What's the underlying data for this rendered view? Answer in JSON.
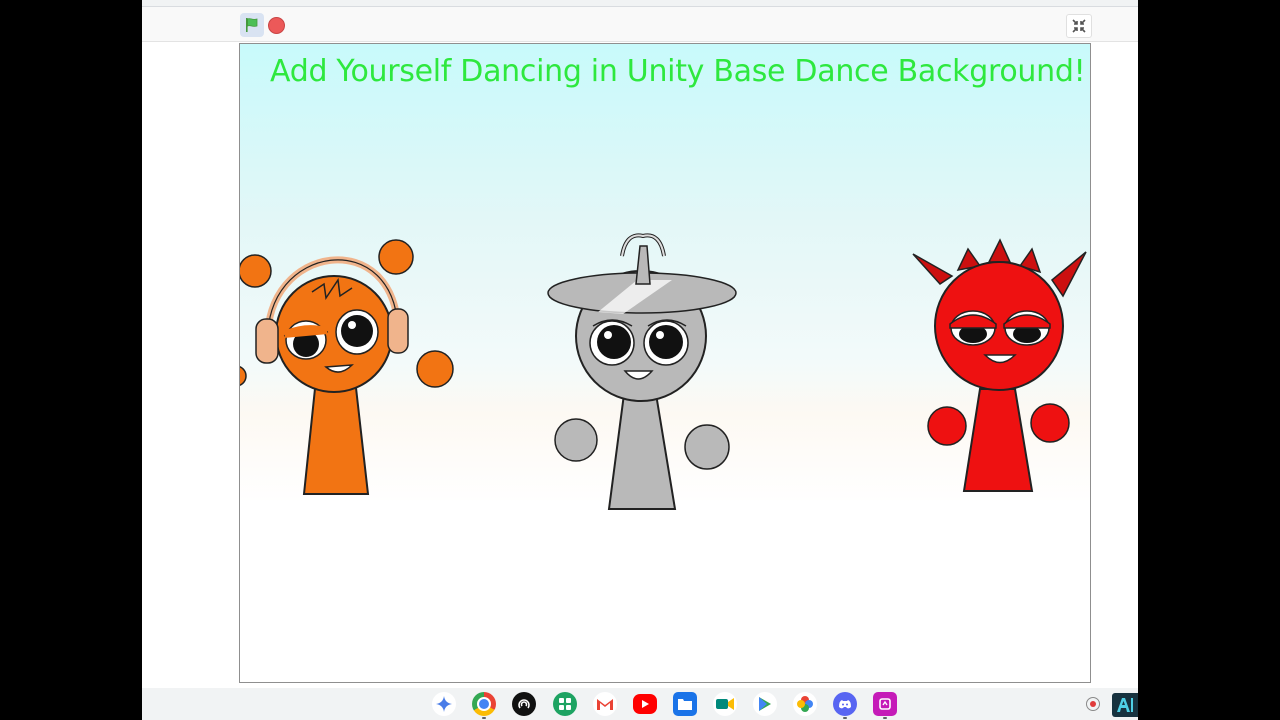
{
  "stage": {
    "title": "Add Yourself Dancing in Unity Base Dance Background!"
  },
  "controls": {
    "green_flag_icon": "green-flag-icon",
    "stop_icon": "stop-sign-icon",
    "exit_fullscreen_icon": "exit-fullscreen-icon"
  },
  "characters": [
    {
      "name": "orange-headphones-character",
      "color": "#f27413"
    },
    {
      "name": "gray-hat-character",
      "color": "#b9b9b9"
    },
    {
      "name": "red-spiky-character",
      "color": "#ee1111"
    }
  ],
  "colors": {
    "title": "#2ee83e",
    "orange": "#f27413",
    "gray": "#b9b9b9",
    "red": "#ee1111"
  },
  "shelf": {
    "apps": [
      {
        "name": "gemini-icon",
        "color": "#ffffff"
      },
      {
        "name": "chrome-icon",
        "color": "#4285f4"
      },
      {
        "name": "podcast-icon",
        "color": "#111111"
      },
      {
        "name": "app-grid-icon",
        "color": "#1ea362"
      },
      {
        "name": "gmail-icon",
        "color": "#ffffff"
      },
      {
        "name": "youtube-icon",
        "color": "#ff0000"
      },
      {
        "name": "files-icon",
        "color": "#1a73e8"
      },
      {
        "name": "meet-icon",
        "color": "#00897b"
      },
      {
        "name": "play-store-icon",
        "color": "#ffffff"
      },
      {
        "name": "photos-icon",
        "color": "#ffffff"
      },
      {
        "name": "discord-icon",
        "color": "#5865f2"
      },
      {
        "name": "screencast-icon",
        "color": "#c51bb8"
      }
    ]
  }
}
